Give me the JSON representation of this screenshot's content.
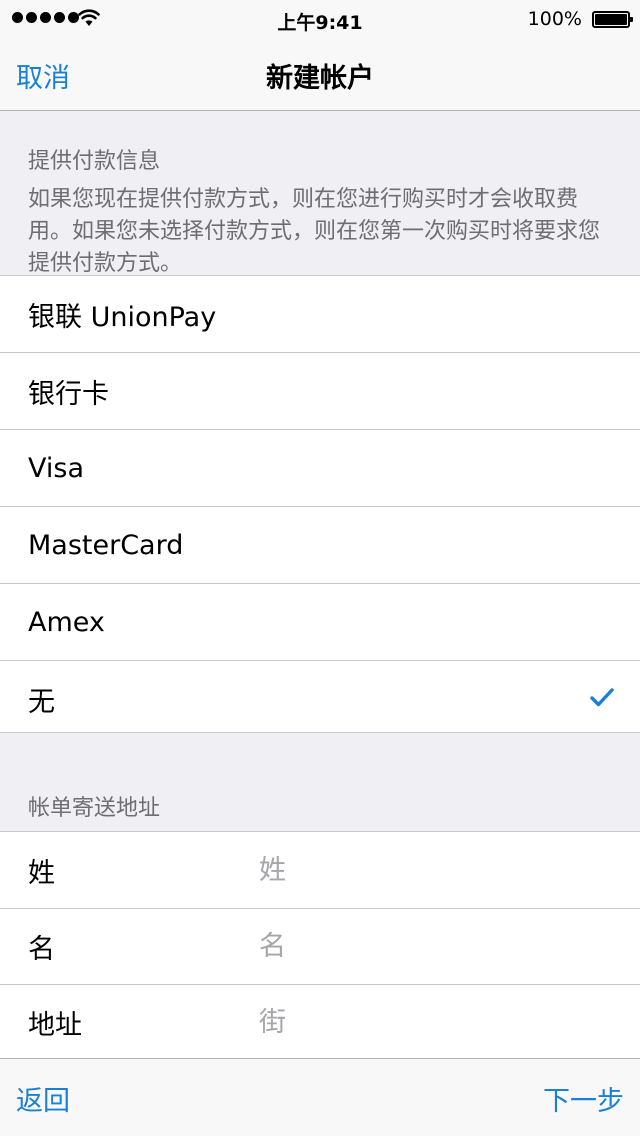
{
  "status_bar": {
    "time": "上午9:41",
    "battery": "100%",
    "signal_icon": "signal-dots-icon",
    "wifi_icon": "wifi-icon",
    "battery_icon": "battery-icon"
  },
  "nav": {
    "cancel": "取消",
    "title": "新建帐户"
  },
  "payment": {
    "title": "提供付款信息",
    "description": "如果您现在提供付款方式，则在您进行购买时才会收取费用。如果您未选择付款方式，则在您第一次购买时将要求您提供付款方式。",
    "options": [
      {
        "label": "银联 UnionPay",
        "selected": false
      },
      {
        "label": "银行卡",
        "selected": false
      },
      {
        "label": "Visa",
        "selected": false
      },
      {
        "label": "MasterCard",
        "selected": false
      },
      {
        "label": "Amex",
        "selected": false
      },
      {
        "label": "无",
        "selected": true
      }
    ],
    "check_icon": "checkmark-icon"
  },
  "billing": {
    "title": "帐单寄送地址",
    "fields": [
      {
        "label": "姓",
        "placeholder": "姓",
        "value": ""
      },
      {
        "label": "名",
        "placeholder": "名",
        "value": ""
      },
      {
        "label": "地址",
        "placeholder": "街",
        "value": ""
      }
    ]
  },
  "toolbar": {
    "back": "返回",
    "next": "下一步"
  },
  "colors": {
    "accent": "#1a7fd6",
    "background": "#efeff4",
    "section_text": "#6d6d72",
    "separator": "#c8c7cc",
    "placeholder": "#a5a5aa"
  }
}
